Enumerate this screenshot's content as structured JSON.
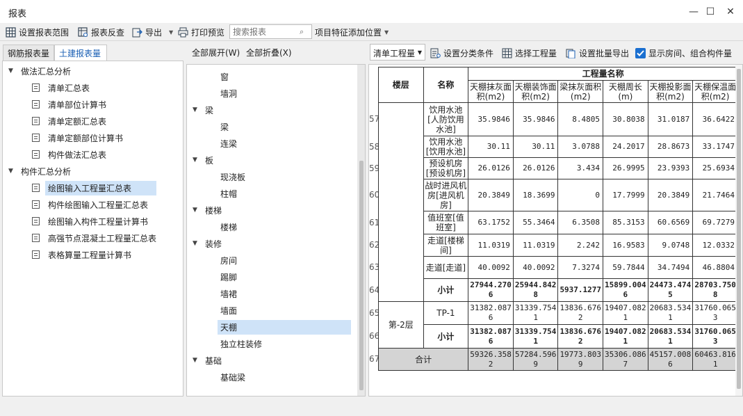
{
  "window": {
    "title": "报表",
    "minimize": "—",
    "maximize": "☐",
    "close": "✕"
  },
  "toolbar": {
    "set_range": "设置报表范围",
    "reverse": "报表反查",
    "export": "导出",
    "print_preview": "打印预览",
    "search_placeholder": "搜索报表",
    "feature_position": "项目特征添加位置"
  },
  "left_tabs": {
    "tab1": "钢筋报表量",
    "tab2": "土建报表量"
  },
  "left_tree": [
    {
      "label": "做法汇总分析",
      "level": 0
    },
    {
      "label": "清单汇总表",
      "level": 1
    },
    {
      "label": "清单部位计算书",
      "level": 1
    },
    {
      "label": "清单定额汇总表",
      "level": 1
    },
    {
      "label": "清单定额部位计算书",
      "level": 1
    },
    {
      "label": "构件做法汇总表",
      "level": 1
    },
    {
      "label": "构件汇总分析",
      "level": 0
    },
    {
      "label": "绘图输入工程量汇总表",
      "level": 1,
      "selected": true
    },
    {
      "label": "构件绘图输入工程量汇总表",
      "level": 1
    },
    {
      "label": "绘图输入构件工程量计算书",
      "level": 1
    },
    {
      "label": "高强节点混凝土工程量汇总表",
      "level": 1
    },
    {
      "label": "表格算量工程量计算书",
      "level": 1
    }
  ],
  "mid_header": {
    "expand_all": "全部展开(W)",
    "collapse_all": "全部折叠(X)"
  },
  "mid_tree": [
    {
      "label": "窗",
      "level": 1
    },
    {
      "label": "墙洞",
      "level": 1
    },
    {
      "label": "梁",
      "level": 0
    },
    {
      "label": "梁",
      "level": 1
    },
    {
      "label": "连梁",
      "level": 1
    },
    {
      "label": "板",
      "level": 0
    },
    {
      "label": "现浇板",
      "level": 1
    },
    {
      "label": "柱帽",
      "level": 1
    },
    {
      "label": "楼梯",
      "level": 0
    },
    {
      "label": "楼梯",
      "level": 1
    },
    {
      "label": "装修",
      "level": 0
    },
    {
      "label": "房间",
      "level": 1
    },
    {
      "label": "踢脚",
      "level": 1
    },
    {
      "label": "墙裙",
      "level": 1
    },
    {
      "label": "墙面",
      "level": 1
    },
    {
      "label": "天棚",
      "level": 1,
      "selected": true
    },
    {
      "label": "独立柱装修",
      "level": 1
    },
    {
      "label": "基础",
      "level": 0
    },
    {
      "label": "基础梁",
      "level": 1
    }
  ],
  "right_toolbar": {
    "dropdown": "清单工程量",
    "classify": "设置分类条件",
    "select_qty": "选择工程量",
    "batch_export": "设置批量导出",
    "show_rooms": "显示房间、组合构件量"
  },
  "table": {
    "h_floor": "楼层",
    "h_name": "名称",
    "h_group": "工程量名称",
    "cols": [
      "天棚抹灰面积(m2)",
      "天棚装饰面积(m2)",
      "梁抹灰面积(m2)",
      "天棚周长(m)",
      "天棚投影面积(m2)",
      "天棚保温面积(m2)"
    ],
    "rows": [
      {
        "n": "57",
        "name": "饮用水池[人防饮用水池]",
        "v": [
          "35.9846",
          "35.9846",
          "8.4805",
          "30.8038",
          "31.0187",
          "36.6422"
        ]
      },
      {
        "n": "58",
        "name": "饮用水池[饮用水池]",
        "v": [
          "30.11",
          "30.11",
          "3.0788",
          "24.2017",
          "28.8673",
          "33.1747"
        ]
      },
      {
        "n": "59",
        "name": "预设机房[预设机房]",
        "v": [
          "26.0126",
          "26.0126",
          "3.434",
          "26.9995",
          "23.9393",
          "25.6934"
        ]
      },
      {
        "n": "60",
        "name": "战时进风机房[进风机房]",
        "v": [
          "20.3849",
          "18.3699",
          "0",
          "17.7999",
          "20.3849",
          "21.7464"
        ]
      },
      {
        "n": "61",
        "name": "值班室[值班室]",
        "v": [
          "63.1752",
          "55.3464",
          "6.3508",
          "85.3153",
          "60.6569",
          "69.7279"
        ]
      },
      {
        "n": "62",
        "name": "走道[楼梯间]",
        "v": [
          "11.0319",
          "11.0319",
          "2.242",
          "16.9583",
          "9.0748",
          "12.0332"
        ]
      },
      {
        "n": "63",
        "name": "走道[走道]",
        "v": [
          "40.0092",
          "40.0092",
          "7.3274",
          "59.7844",
          "34.7494",
          "46.8804"
        ]
      },
      {
        "n": "64",
        "name": "小计",
        "v": [
          "27944.2706",
          "25944.8428",
          "5937.1277",
          "15899.0046",
          "24473.4745",
          "28703.7508"
        ]
      },
      {
        "n": "65",
        "floor": "第-2层",
        "name": "TP-1",
        "v": [
          "31382.0876",
          "31339.7541",
          "13836.6762",
          "19407.0821",
          "20683.5341",
          "31760.0653"
        ]
      },
      {
        "n": "66",
        "name": "小计",
        "v": [
          "31382.0876",
          "31339.7541",
          "13836.6762",
          "19407.0821",
          "20683.5341",
          "31760.0653"
        ]
      },
      {
        "n": "67",
        "name": "合计",
        "v": [
          "59326.3582",
          "57284.5969",
          "19773.8039",
          "35306.0867",
          "45157.0086",
          "60463.8161"
        ]
      }
    ]
  }
}
